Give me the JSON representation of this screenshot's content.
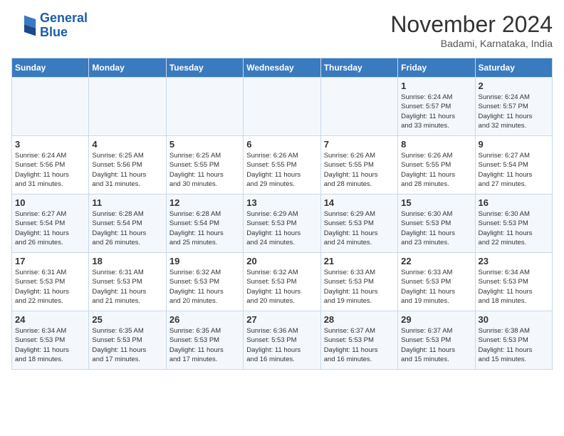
{
  "logo": {
    "line1": "General",
    "line2": "Blue"
  },
  "title": "November 2024",
  "location": "Badami, Karnataka, India",
  "days_of_week": [
    "Sunday",
    "Monday",
    "Tuesday",
    "Wednesday",
    "Thursday",
    "Friday",
    "Saturday"
  ],
  "weeks": [
    [
      {
        "day": "",
        "info": ""
      },
      {
        "day": "",
        "info": ""
      },
      {
        "day": "",
        "info": ""
      },
      {
        "day": "",
        "info": ""
      },
      {
        "day": "",
        "info": ""
      },
      {
        "day": "1",
        "info": "Sunrise: 6:24 AM\nSunset: 5:57 PM\nDaylight: 11 hours\nand 33 minutes."
      },
      {
        "day": "2",
        "info": "Sunrise: 6:24 AM\nSunset: 5:57 PM\nDaylight: 11 hours\nand 32 minutes."
      }
    ],
    [
      {
        "day": "3",
        "info": "Sunrise: 6:24 AM\nSunset: 5:56 PM\nDaylight: 11 hours\nand 31 minutes."
      },
      {
        "day": "4",
        "info": "Sunrise: 6:25 AM\nSunset: 5:56 PM\nDaylight: 11 hours\nand 31 minutes."
      },
      {
        "day": "5",
        "info": "Sunrise: 6:25 AM\nSunset: 5:55 PM\nDaylight: 11 hours\nand 30 minutes."
      },
      {
        "day": "6",
        "info": "Sunrise: 6:26 AM\nSunset: 5:55 PM\nDaylight: 11 hours\nand 29 minutes."
      },
      {
        "day": "7",
        "info": "Sunrise: 6:26 AM\nSunset: 5:55 PM\nDaylight: 11 hours\nand 28 minutes."
      },
      {
        "day": "8",
        "info": "Sunrise: 6:26 AM\nSunset: 5:55 PM\nDaylight: 11 hours\nand 28 minutes."
      },
      {
        "day": "9",
        "info": "Sunrise: 6:27 AM\nSunset: 5:54 PM\nDaylight: 11 hours\nand 27 minutes."
      }
    ],
    [
      {
        "day": "10",
        "info": "Sunrise: 6:27 AM\nSunset: 5:54 PM\nDaylight: 11 hours\nand 26 minutes."
      },
      {
        "day": "11",
        "info": "Sunrise: 6:28 AM\nSunset: 5:54 PM\nDaylight: 11 hours\nand 26 minutes."
      },
      {
        "day": "12",
        "info": "Sunrise: 6:28 AM\nSunset: 5:54 PM\nDaylight: 11 hours\nand 25 minutes."
      },
      {
        "day": "13",
        "info": "Sunrise: 6:29 AM\nSunset: 5:53 PM\nDaylight: 11 hours\nand 24 minutes."
      },
      {
        "day": "14",
        "info": "Sunrise: 6:29 AM\nSunset: 5:53 PM\nDaylight: 11 hours\nand 24 minutes."
      },
      {
        "day": "15",
        "info": "Sunrise: 6:30 AM\nSunset: 5:53 PM\nDaylight: 11 hours\nand 23 minutes."
      },
      {
        "day": "16",
        "info": "Sunrise: 6:30 AM\nSunset: 5:53 PM\nDaylight: 11 hours\nand 22 minutes."
      }
    ],
    [
      {
        "day": "17",
        "info": "Sunrise: 6:31 AM\nSunset: 5:53 PM\nDaylight: 11 hours\nand 22 minutes."
      },
      {
        "day": "18",
        "info": "Sunrise: 6:31 AM\nSunset: 5:53 PM\nDaylight: 11 hours\nand 21 minutes."
      },
      {
        "day": "19",
        "info": "Sunrise: 6:32 AM\nSunset: 5:53 PM\nDaylight: 11 hours\nand 20 minutes."
      },
      {
        "day": "20",
        "info": "Sunrise: 6:32 AM\nSunset: 5:53 PM\nDaylight: 11 hours\nand 20 minutes."
      },
      {
        "day": "21",
        "info": "Sunrise: 6:33 AM\nSunset: 5:53 PM\nDaylight: 11 hours\nand 19 minutes."
      },
      {
        "day": "22",
        "info": "Sunrise: 6:33 AM\nSunset: 5:53 PM\nDaylight: 11 hours\nand 19 minutes."
      },
      {
        "day": "23",
        "info": "Sunrise: 6:34 AM\nSunset: 5:53 PM\nDaylight: 11 hours\nand 18 minutes."
      }
    ],
    [
      {
        "day": "24",
        "info": "Sunrise: 6:34 AM\nSunset: 5:53 PM\nDaylight: 11 hours\nand 18 minutes."
      },
      {
        "day": "25",
        "info": "Sunrise: 6:35 AM\nSunset: 5:53 PM\nDaylight: 11 hours\nand 17 minutes."
      },
      {
        "day": "26",
        "info": "Sunrise: 6:35 AM\nSunset: 5:53 PM\nDaylight: 11 hours\nand 17 minutes."
      },
      {
        "day": "27",
        "info": "Sunrise: 6:36 AM\nSunset: 5:53 PM\nDaylight: 11 hours\nand 16 minutes."
      },
      {
        "day": "28",
        "info": "Sunrise: 6:37 AM\nSunset: 5:53 PM\nDaylight: 11 hours\nand 16 minutes."
      },
      {
        "day": "29",
        "info": "Sunrise: 6:37 AM\nSunset: 5:53 PM\nDaylight: 11 hours\nand 15 minutes."
      },
      {
        "day": "30",
        "info": "Sunrise: 6:38 AM\nSunset: 5:53 PM\nDaylight: 11 hours\nand 15 minutes."
      }
    ]
  ]
}
